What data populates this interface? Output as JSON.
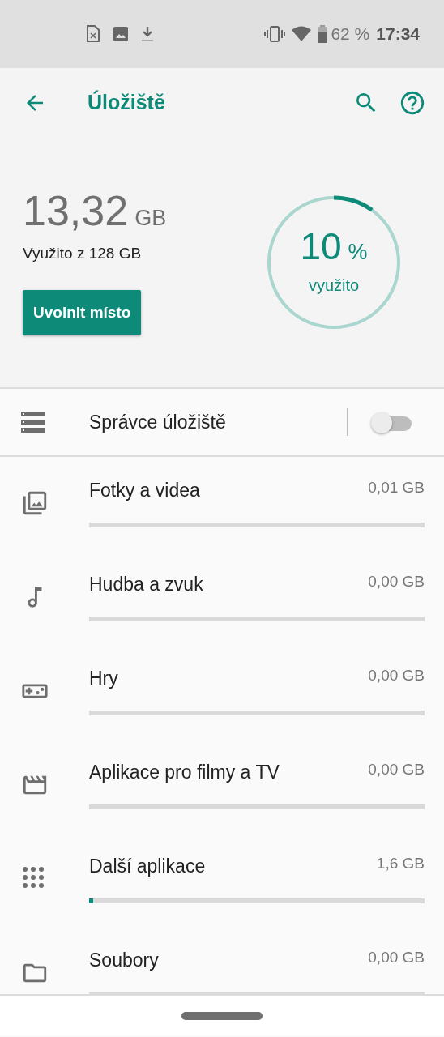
{
  "status_bar": {
    "battery_text": "62 %",
    "time": "17:34"
  },
  "app_bar": {
    "title": "Úložiště"
  },
  "summary": {
    "used_amount": "13,32",
    "used_unit": "GB",
    "used_of": "Využito z 128 GB",
    "button": "Uvolnit místo",
    "gauge": {
      "percent": "10",
      "percent_sign": "%",
      "caption": "využito"
    }
  },
  "storage_manager": {
    "label": "Správce úložiště",
    "on": false
  },
  "categories": [
    {
      "kind": "photos",
      "label": "Fotky a videa",
      "size": "0,01 GB"
    },
    {
      "kind": "music",
      "label": "Hudba a zvuk",
      "size": "0,00 GB"
    },
    {
      "kind": "games",
      "label": "Hry",
      "size": "0,00 GB"
    },
    {
      "kind": "movies",
      "label": "Aplikace pro filmy a TV",
      "size": "0,00 GB"
    },
    {
      "kind": "apps",
      "label": "Další aplikace",
      "size": "1,6 GB",
      "level": 0.012
    },
    {
      "kind": "files",
      "label": "Soubory",
      "size": "0,00 GB"
    }
  ]
}
